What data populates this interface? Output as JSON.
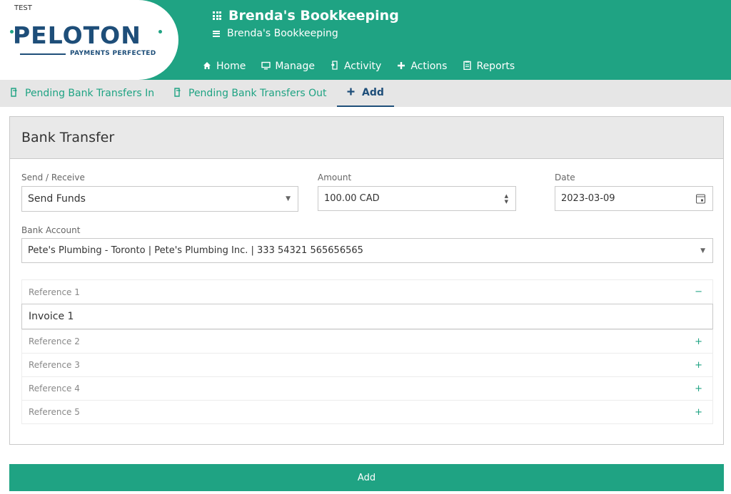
{
  "env_tag": "TEST",
  "logo": {
    "word": "PELOTON",
    "tagline": "PAYMENTS PERFECTED"
  },
  "org": {
    "title": "Brenda's Bookkeeping",
    "subtitle": "Brenda's Bookkeeping"
  },
  "topnav": [
    {
      "label": "Home",
      "icon": "home-icon"
    },
    {
      "label": "Manage",
      "icon": "monitor-icon"
    },
    {
      "label": "Activity",
      "icon": "document-arrow-icon"
    },
    {
      "label": "Actions",
      "icon": "plus-icon"
    },
    {
      "label": "Reports",
      "icon": "clipboard-icon"
    }
  ],
  "subtabs": [
    {
      "label": "Pending Bank Transfers In",
      "icon": "transfer-doc-icon"
    },
    {
      "label": "Pending Bank Transfers Out",
      "icon": "transfer-doc-icon"
    },
    {
      "label": "Add",
      "icon": "plus-icon",
      "active": true
    }
  ],
  "panel": {
    "title": "Bank Transfer"
  },
  "form": {
    "send_receive": {
      "label": "Send / Receive",
      "value": "Send Funds"
    },
    "amount": {
      "label": "Amount",
      "value": "100.00 CAD"
    },
    "date": {
      "label": "Date",
      "value": "2023-03-09"
    },
    "bank_account": {
      "label": "Bank Account",
      "value": "Pete's Plumbing - Toronto | Pete's Plumbing Inc. | 333 54321 565656565"
    }
  },
  "references": [
    {
      "label": "Reference 1",
      "toggle": "−",
      "expanded": true,
      "value": "Invoice 1"
    },
    {
      "label": "Reference 2",
      "toggle": "+"
    },
    {
      "label": "Reference 3",
      "toggle": "+"
    },
    {
      "label": "Reference 4",
      "toggle": "+"
    },
    {
      "label": "Reference 5",
      "toggle": "+"
    }
  ],
  "submit_label": "Add",
  "colors": {
    "brand_green": "#1fa383",
    "brand_navy": "#1e4e79"
  }
}
